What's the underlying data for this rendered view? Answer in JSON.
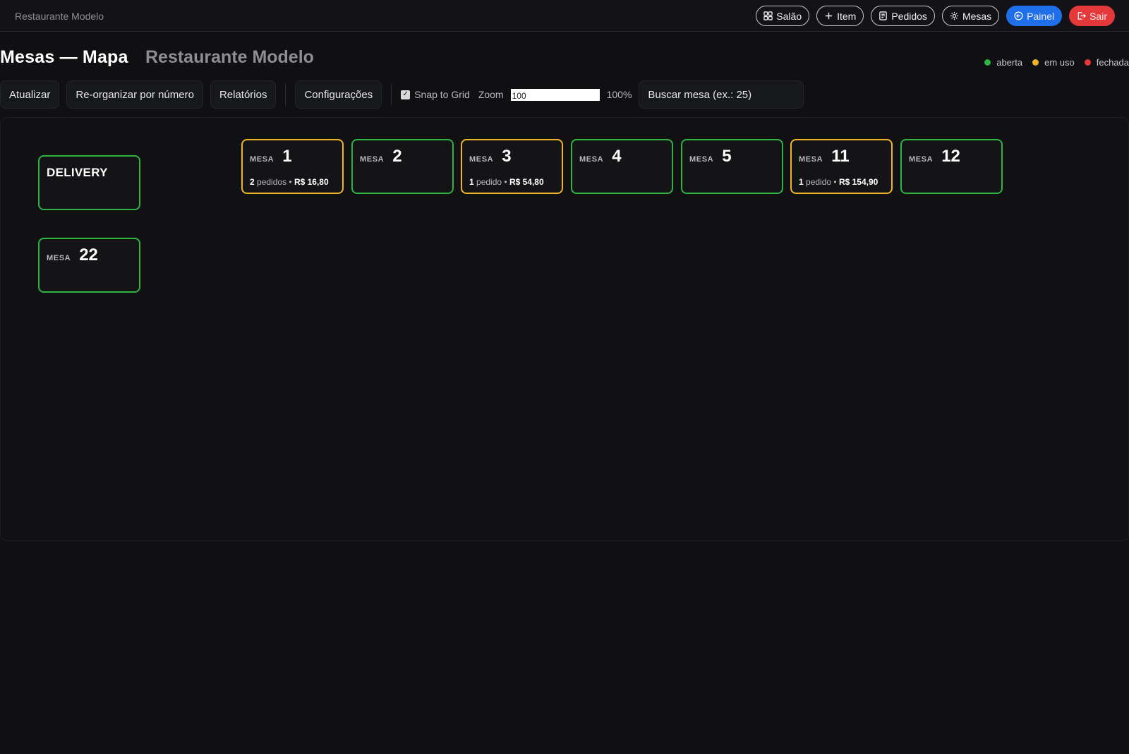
{
  "app": {
    "brand": "Restaurante Modelo"
  },
  "nav": {
    "items": [
      {
        "label": "Salão",
        "icon": "grid-icon",
        "style": "outline"
      },
      {
        "label": "Item",
        "icon": "plus-icon",
        "style": "outline"
      },
      {
        "label": "Pedidos",
        "icon": "receipt-icon",
        "style": "outline"
      },
      {
        "label": "Mesas",
        "icon": "gear-icon",
        "style": "outline"
      },
      {
        "label": "Painel",
        "icon": "back-arrow-icon",
        "style": "primary"
      },
      {
        "label": "Sair",
        "icon": "logout-icon",
        "style": "danger"
      }
    ]
  },
  "header": {
    "title": "Mesas — Mapa",
    "subtitle": "Restaurante Modelo"
  },
  "legend": [
    {
      "label": "aberta",
      "color": "#2fb344"
    },
    {
      "label": "em uso",
      "color": "#f0b429"
    },
    {
      "label": "fechada",
      "color": "#e5383b"
    }
  ],
  "toolbar": {
    "refresh_label": "Atualizar",
    "reorganize_label": "Re-organizar por número",
    "reports_label": "Relatórios",
    "settings_label": "Configurações",
    "snap_label": "Snap to Grid",
    "snap_checked": true,
    "zoom_label": "Zoom",
    "zoom_value": "100",
    "zoom_percent": "100%",
    "search_placeholder": "Buscar mesa (ex.: 25)"
  },
  "map": {
    "mesa_label": "MESA",
    "delivery_label": "DELIVERY",
    "tables": [
      {
        "number": "1",
        "status": "em uso",
        "orders_count": "2",
        "orders_word": "pedidos",
        "total": "R$ 16,80"
      },
      {
        "number": "2",
        "status": "aberta"
      },
      {
        "number": "3",
        "status": "em uso",
        "orders_count": "1",
        "orders_word": "pedido",
        "total": "R$ 54,80"
      },
      {
        "number": "4",
        "status": "aberta"
      },
      {
        "number": "5",
        "status": "aberta"
      },
      {
        "number": "11",
        "status": "em uso",
        "orders_count": "1",
        "orders_word": "pedido",
        "total": "R$ 154,90"
      },
      {
        "number": "12",
        "status": "aberta"
      },
      {
        "number": "22",
        "status": "aberta"
      }
    ]
  }
}
